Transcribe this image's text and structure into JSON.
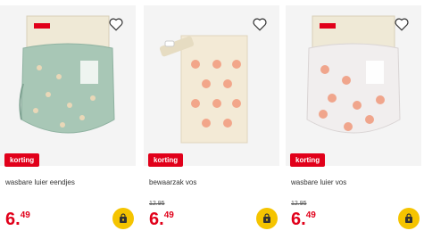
{
  "colors": {
    "accent_red": "#e1001a",
    "cart_yellow": "#f5c400",
    "tile_bg": "#f4f4f4"
  },
  "products": [
    {
      "name": "wasbare luier eendjes",
      "old_price": "",
      "price_euros": "6.",
      "price_cents": "49",
      "badge": "korting",
      "image": "diaper-with-ducks",
      "brand_tag": "hema"
    },
    {
      "name": "bewaarzak vos",
      "old_price": "12.95",
      "price_euros": "6.",
      "price_cents": "49",
      "badge": "korting",
      "image": "wet-bag-with-foxes"
    },
    {
      "name": "wasbare luier vos",
      "old_price": "12.95",
      "price_euros": "6.",
      "price_cents": "49",
      "badge": "korting",
      "image": "diaper-with-foxes",
      "brand_tag": "hema"
    }
  ]
}
